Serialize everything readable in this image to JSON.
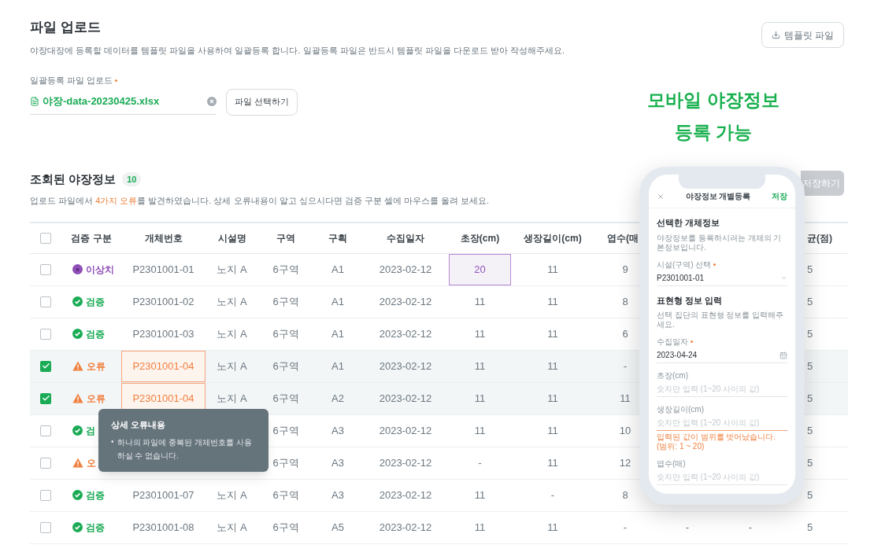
{
  "header": {
    "title": "파일 업로드",
    "description": "야장대장에 등록할 데이터를 템플릿 파일을 사용하여 일괄등록 합니다. 일괄등록 파일은 반드시 템플릿 파일을 다운로드 받아 작성해주세요.",
    "template_button": "템플릿 파일"
  },
  "upload": {
    "label": "일괄등록 파일 업로드",
    "required": true,
    "file_name": "야장-data-20230425.xlsx",
    "select_button": "파일 선택하기"
  },
  "promo": {
    "lines": [
      "모바일 야장정보",
      "등록 가능"
    ]
  },
  "results": {
    "title": "조회된 야장정보",
    "count": "10",
    "message": {
      "before": "업로드 파일에서 ",
      "highlight": "4가지 오류",
      "after": "를 발견하였습니다. 상세 오류내용이 알고 싶으시다면 검증 구분 셀에 마우스를 올려 보세요."
    },
    "save_button": "저장하기"
  },
  "table": {
    "all_checked": false,
    "columns": [
      "검증 구분",
      "개체번호",
      "시설명",
      "구역",
      "구획",
      "수집일자",
      "초장(cm)",
      "생장길이(cm)",
      "엽수(매",
      null,
      null,
      "균(점)"
    ],
    "rows": [
      {
        "checked": false,
        "cells": [
          {
            "kind": "outlier",
            "label": "이상치"
          },
          "P2301001-01",
          "노지 A",
          "6구역",
          "A1",
          "2023-02-12",
          {
            "text": "20",
            "kind": "outlier"
          },
          "11",
          "9",
          null,
          null,
          "5"
        ]
      },
      {
        "checked": false,
        "cells": [
          {
            "kind": "ok",
            "label": "검증"
          },
          "P2301001-02",
          "노지 A",
          "6구역",
          "A1",
          "2023-02-12",
          "11",
          "11",
          "8",
          null,
          null,
          "5"
        ]
      },
      {
        "checked": false,
        "cells": [
          {
            "kind": "ok",
            "label": "검증"
          },
          "P2301001-03",
          "노지 A",
          "6구역",
          "A1",
          "2023-02-12",
          "11",
          "11",
          "6",
          null,
          null,
          "5"
        ]
      },
      {
        "checked": true,
        "cells": [
          {
            "kind": "error",
            "label": "오류"
          },
          {
            "text": "P2301001-04",
            "kind": "error"
          },
          "노지 A",
          "6구역",
          "A1",
          "2023-02-12",
          "11",
          "11",
          "-",
          null,
          null,
          "5"
        ]
      },
      {
        "checked": true,
        "cells": [
          {
            "kind": "error",
            "label": "오류"
          },
          {
            "text": "P2301001-04",
            "kind": "error"
          },
          "노지 A",
          "6구역",
          "A2",
          "2023-02-12",
          "11",
          "11",
          "11",
          null,
          null,
          "5"
        ]
      },
      {
        "checked": false,
        "cells": [
          {
            "kind": "ok",
            "label": "검"
          },
          null,
          null,
          "6구역",
          "A3",
          "2023-02-12",
          "11",
          "11",
          "10",
          null,
          null,
          "5"
        ]
      },
      {
        "checked": false,
        "cells": [
          {
            "kind": "error",
            "label": "오"
          },
          null,
          null,
          "6구역",
          "A3",
          "2023-02-12",
          "-",
          "11",
          "12",
          null,
          null,
          "5"
        ]
      },
      {
        "checked": false,
        "cells": [
          {
            "kind": "ok",
            "label": "검증"
          },
          "P2301001-07",
          "노지 A",
          "6구역",
          "A3",
          "2023-02-12",
          "11",
          "-",
          "8",
          null,
          null,
          "5"
        ]
      },
      {
        "checked": false,
        "cells": [
          {
            "kind": "ok",
            "label": "검증"
          },
          "P2301001-08",
          "노지 A",
          "6구역",
          "A5",
          "2023-02-12",
          "11",
          "11",
          "-",
          "-",
          "-",
          "5"
        ]
      }
    ]
  },
  "tooltip": {
    "title": "상세 오류내용",
    "items": [
      {
        "bullet": "•",
        "text": "하나의 파일에 중복된 개체번호를 사용하실 수 없습니다."
      }
    ]
  },
  "phone": {
    "title": "야장정보 개별등록",
    "save": "저장",
    "sections": [
      {
        "title": "선택한 개체정보",
        "description": "야장정보를 등록하시려는 개체의 기본정보입니다.",
        "fields": [
          {
            "kind": "select",
            "label": "시설(구역) 선택",
            "required": true,
            "value": "P2301001-01"
          }
        ]
      },
      {
        "title": "표현형 정보 입력",
        "description": "선택 집단의 표현형 정보를 입력해주세요.",
        "fields": [
          {
            "kind": "date",
            "label": "수집일자",
            "required": true,
            "value": "2023-04-24"
          },
          {
            "kind": "text",
            "label": "초장(cm)",
            "required": false,
            "placeholder": "숫자만 입력 (1~20 사이의 값)"
          },
          {
            "kind": "text",
            "label": "생장길이(cm)",
            "required": false,
            "placeholder": "숫자만 입력 (1~20 사이의 값)",
            "error": "입력된 값이 범위를 벗어났습니다. (범위: 1 ~ 20)"
          },
          {
            "kind": "text",
            "label": "엽수(매)",
            "required": false,
            "placeholder": "숫자만 입력 (1~20 사이의 값)"
          }
        ]
      }
    ]
  }
}
